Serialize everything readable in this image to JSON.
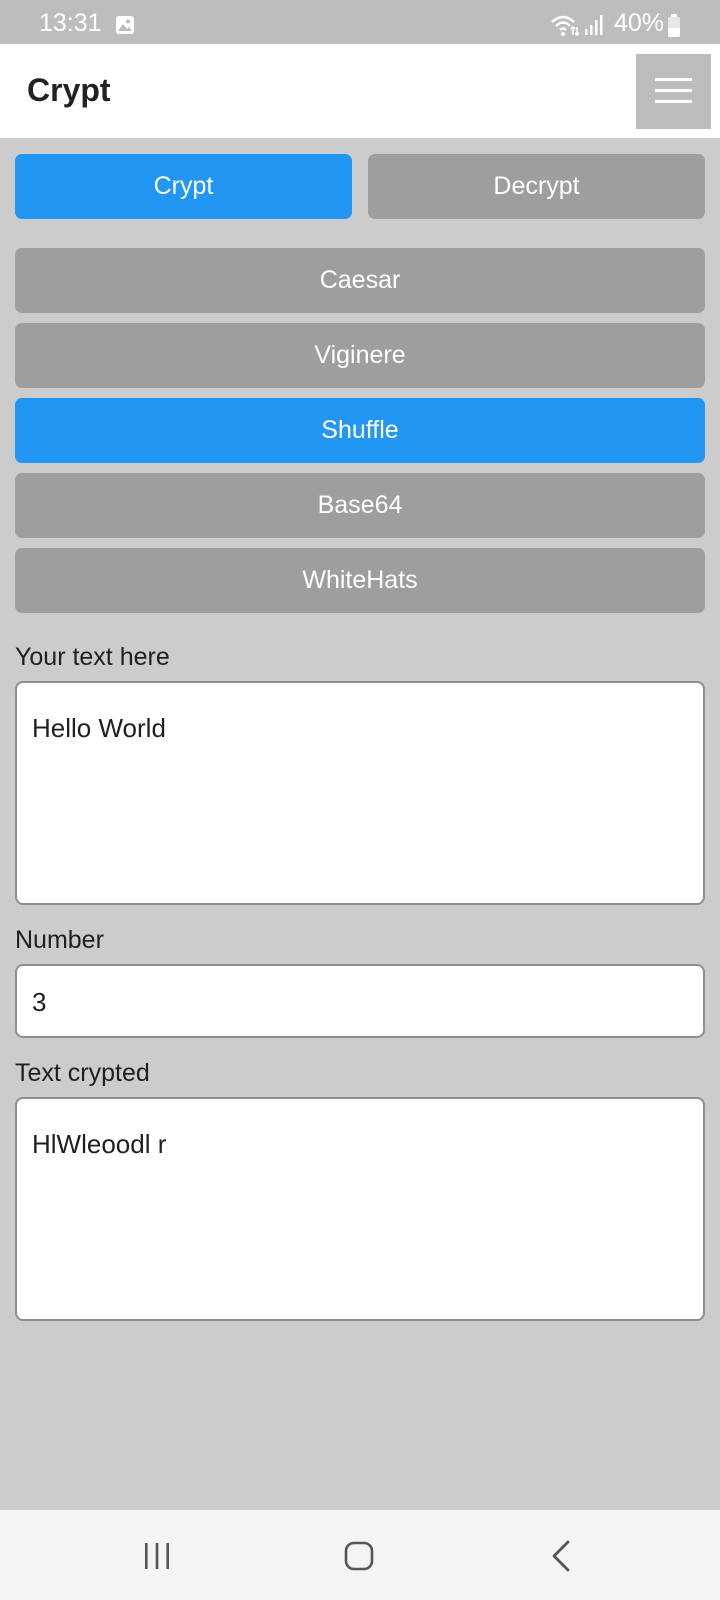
{
  "status_bar": {
    "time": "13:31",
    "battery": "40%",
    "icons": [
      "gallery-icon",
      "wifi-icon",
      "signal-icon",
      "battery-icon"
    ]
  },
  "app_bar": {
    "title": "Crypt",
    "menu_icon": "hamburger-menu-icon"
  },
  "mode_tabs": [
    {
      "label": "Crypt",
      "active": true
    },
    {
      "label": "Decrypt",
      "active": false
    }
  ],
  "methods": [
    {
      "label": "Caesar",
      "active": false
    },
    {
      "label": "Viginere",
      "active": false
    },
    {
      "label": "Shuffle",
      "active": true
    },
    {
      "label": "Base64",
      "active": false
    },
    {
      "label": "WhiteHats",
      "active": false
    }
  ],
  "form": {
    "input_label": "Your text here",
    "input_value": "Hello World",
    "number_label": "Number",
    "number_value": "3",
    "output_label": "Text crypted",
    "output_value": "HlWleoodl r"
  },
  "nav_bar": {
    "icons": [
      "recents-icon",
      "home-icon",
      "back-icon"
    ]
  },
  "colors": {
    "active": "#2196f3",
    "inactive": "#9e9e9e",
    "background": "#cccccc"
  }
}
